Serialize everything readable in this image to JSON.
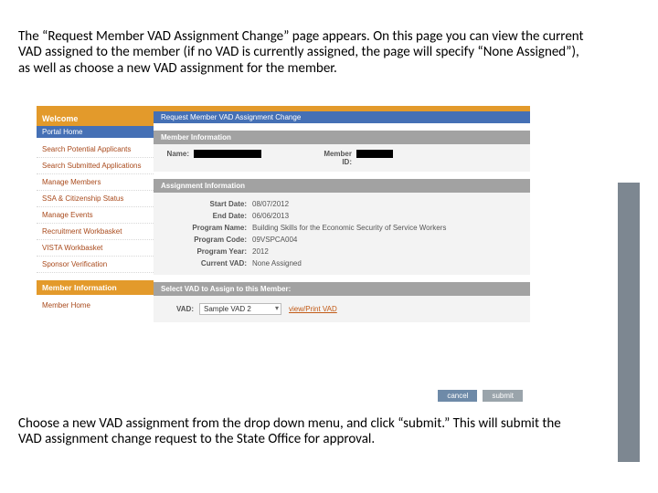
{
  "doc": {
    "intro": "The “Request Member VAD Assignment Change” page appears. On this page you can view the current VAD assigned to the member (if no VAD is currently assigned, the page will specify “None Assigned”), as well as choose a new VAD assignment for the member.",
    "outro": "Choose a new VAD assignment from the drop down menu, and click “submit.” This will submit the VAD assignment change request to the State Office for approval."
  },
  "sidebar": {
    "welcome": "Welcome",
    "portal": "Portal Home",
    "items": [
      "Search Potential Applicants",
      "Search Submitted Applications",
      "Manage Members",
      "SSA & Citizenship Status",
      "Manage Events",
      "Recruitment Workbasket",
      "VISTA Workbasket",
      "Sponsor Verification"
    ],
    "mi_header": "Member Information",
    "mi_item": "Member Home"
  },
  "main": {
    "crumb": "Request Member VAD Assignment Change",
    "sections": {
      "member": {
        "title": "Member Information",
        "name_label": "Name:",
        "id_label": "Member ID:"
      },
      "assignment": {
        "title": "Assignment Information",
        "rows": [
          {
            "label": "Start Date:",
            "value": "08/07/2012"
          },
          {
            "label": "End Date:",
            "value": "06/06/2013"
          },
          {
            "label": "Program Name:",
            "value": "Building Skills for the Economic Security of Service Workers"
          },
          {
            "label": "Program Code:",
            "value": "09VSPCA004"
          },
          {
            "label": "Program Year:",
            "value": "2012"
          },
          {
            "label": "Current VAD:",
            "value": "None Assigned"
          }
        ]
      },
      "select": {
        "title": "Select VAD to Assign to this Member:",
        "label": "VAD:",
        "selected": "Sample VAD 2",
        "link": "view/Print VAD"
      }
    },
    "buttons": {
      "cancel": "cancel",
      "submit": "submit"
    }
  }
}
